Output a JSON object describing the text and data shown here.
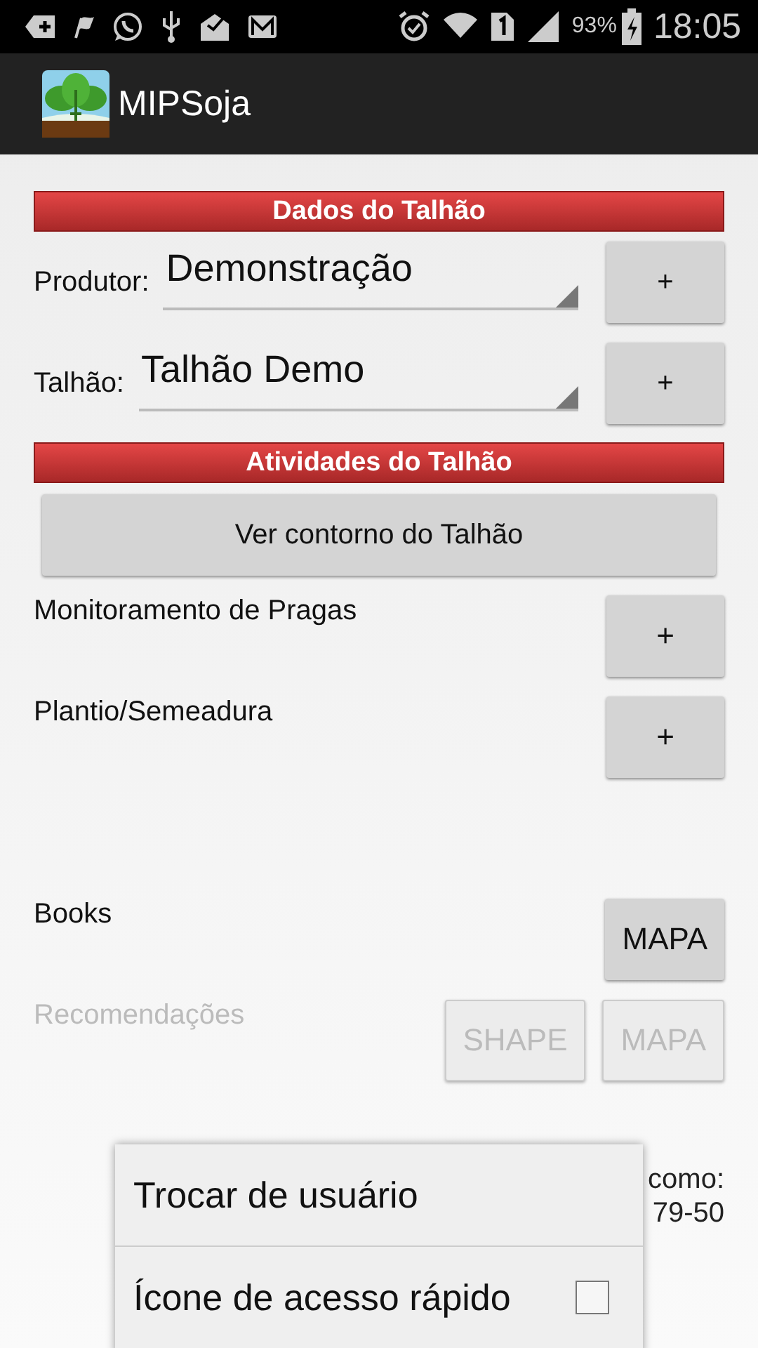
{
  "status_bar": {
    "battery": "93%",
    "time": "18:05"
  },
  "app_bar": {
    "title": "MIPSoja"
  },
  "form": [
    {
      "kind": "header",
      "title": "Dados do Talhão"
    },
    {
      "kind": "spinner",
      "label": "Produtor:",
      "value": "Demonstração",
      "button": "+"
    },
    {
      "kind": "spinner",
      "label": "Talhão:",
      "value": "Talhão Demo",
      "button": "+"
    },
    {
      "kind": "header",
      "title": "Atividades do Talhão"
    },
    {
      "kind": "wide_button",
      "label": "Ver contorno do Talhão"
    },
    {
      "kind": "action",
      "label": "Monitoramento de Pragas",
      "disabled": false,
      "buttons": [
        {
          "label": "+",
          "disabled": false
        }
      ]
    },
    {
      "kind": "action",
      "label": "Plantio/Semeadura",
      "disabled": false,
      "buttons": [
        {
          "label": "+",
          "disabled": false
        }
      ]
    }
  ],
  "links": [
    {
      "kind": "action",
      "label": "Books",
      "disabled": false,
      "buttons": [
        {
          "label": "MAPA",
          "disabled": false
        }
      ]
    },
    {
      "kind": "action",
      "label": "Recomendações",
      "disabled": true,
      "buttons": [
        {
          "label": "SHAPE",
          "disabled": true
        },
        {
          "label": "MAPA",
          "disabled": true
        }
      ]
    }
  ],
  "footer_text": [
    "como:",
    "79-50"
  ],
  "menu": {
    "items": [
      {
        "kind": "plain",
        "label": "Trocar de usuário"
      },
      {
        "kind": "checkbox",
        "label": "Ícone de acesso rápido",
        "checked": false
      }
    ]
  }
}
